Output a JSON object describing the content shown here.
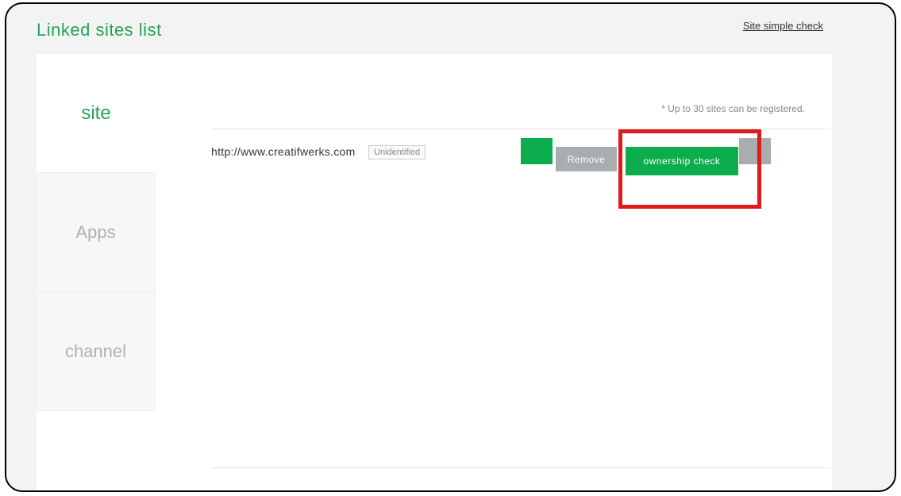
{
  "header": {
    "title": "Linked sites list",
    "simple_check": "Site simple check"
  },
  "sidebar": {
    "items": [
      {
        "label": "site",
        "active": true
      },
      {
        "label": "Apps",
        "active": false
      },
      {
        "label": "channel",
        "active": false
      }
    ]
  },
  "main": {
    "note": "* Up to 30 sites can be registered.",
    "row": {
      "url": "http://www.creatifwerks.com",
      "badge": "Unidentified",
      "remove_label": "Remove",
      "ownership_label": "ownership check"
    }
  }
}
